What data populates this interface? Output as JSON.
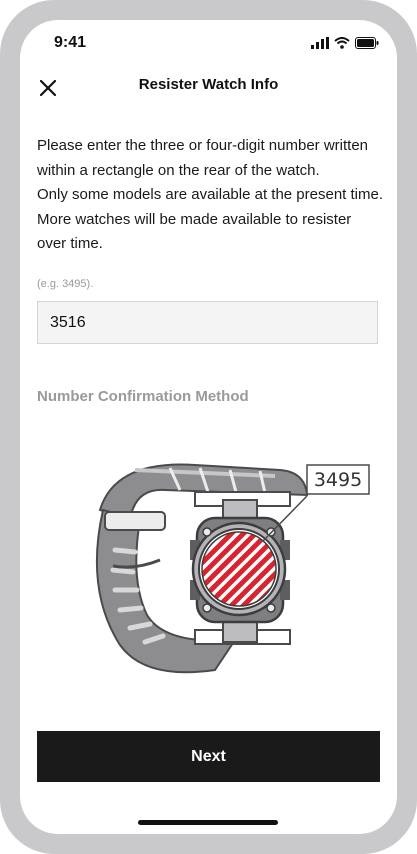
{
  "status_bar": {
    "time": "9:41"
  },
  "header": {
    "title": "Resister Watch Info"
  },
  "description": [
    "Please enter the three or four-digit number written within a rectangle on the rear of the watch.",
    "Only some models are available at the present time. More watches will be made available to resister over time."
  ],
  "input": {
    "example": "(e.g. 3495).",
    "value": "3516"
  },
  "section": {
    "title": "Number Confirmation Method"
  },
  "illustration": {
    "label": "3495",
    "accent_color": "#d9232e"
  },
  "actions": {
    "next_label": "Next"
  }
}
